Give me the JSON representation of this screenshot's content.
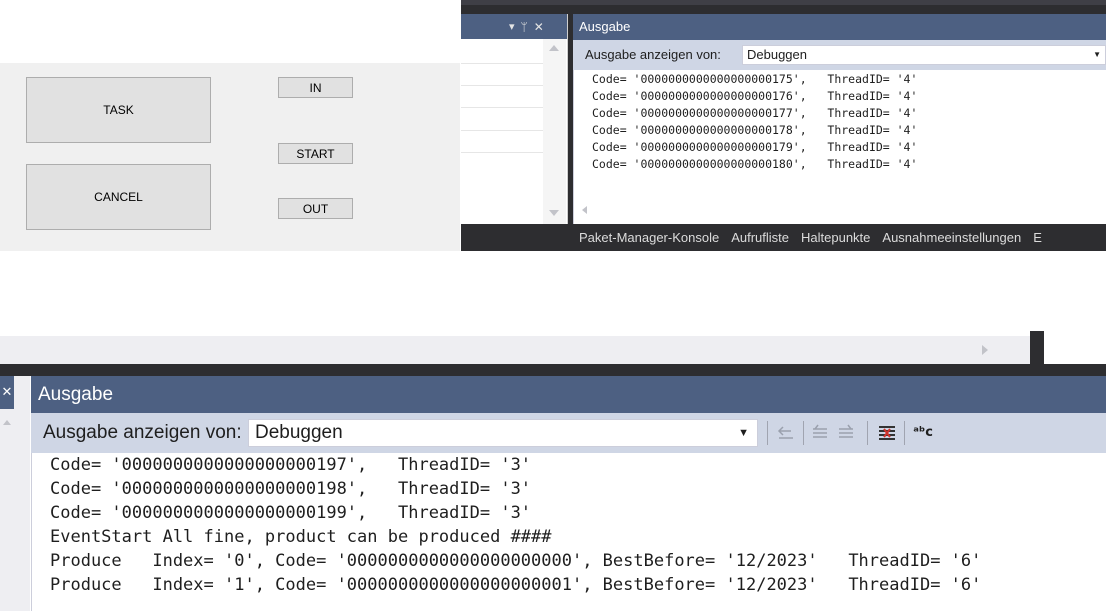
{
  "winform": {
    "task_label": "TASK",
    "cancel_label": "CANCEL",
    "in_label": "IN",
    "start_label": "START",
    "out_label": "OUT"
  },
  "top_left_panel": {
    "icons": [
      "chevron-down-icon",
      "pin-icon",
      "close-icon"
    ],
    "dropdown_glyph": "▾",
    "pin_glyph": "ᛘ",
    "close_glyph": "✕"
  },
  "output_top": {
    "title": "Ausgabe",
    "show_from_label": "Ausgabe anzeigen von:",
    "source_value": "Debuggen",
    "lines": [
      "Code= '0000000000000000000175',   ThreadID= '4'",
      "Code= '0000000000000000000176',   ThreadID= '4'",
      "Code= '0000000000000000000177',   ThreadID= '4'",
      "Code= '0000000000000000000178',   ThreadID= '4'",
      "Code= '0000000000000000000179',   ThreadID= '4'",
      "Code= '0000000000000000000180',   ThreadID= '4'"
    ],
    "tabs": [
      "Paket-Manager-Konsole",
      "Aufrufliste",
      "Haltepunkte",
      "Ausnahmeeinstellungen",
      "E"
    ]
  },
  "output_bottom": {
    "title": "Ausgabe",
    "show_from_label": "Ausgabe anzeigen von:",
    "source_value": "Debuggen",
    "lines": [
      "Code= '0000000000000000000197',   ThreadID= '3'",
      "Code= '0000000000000000000198',   ThreadID= '3'",
      "Code= '0000000000000000000199',   ThreadID= '3'",
      "EventStart All fine, product can be produced ####",
      "Produce   Index= '0', Code= '0000000000000000000000', BestBefore= '12/2023'   ThreadID= '6'",
      "Produce   Index= '1', Code= '0000000000000000000001', BestBefore= '12/2023'   ThreadID= '6'"
    ],
    "toolbar_icons": [
      "go-to-previous-message-icon",
      "go-to-previous-icon",
      "go-to-next-icon",
      "clear-all-icon",
      "toggle-word-wrap-icon"
    ],
    "word_wrap_glyph": "ᵃᵇc"
  },
  "colors": {
    "vs_title_blue": "#4d6082",
    "vs_toolbar": "#cfd6e5",
    "vs_dark": "#2d2d30",
    "winform_bg": "#f0f0f0"
  }
}
